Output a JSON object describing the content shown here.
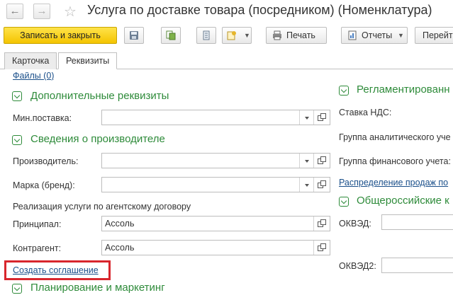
{
  "header": {
    "title": "Услуга по доставке товара (посредником) (Номенклатура)"
  },
  "toolbar": {
    "save_close_label": "Записать и закрыть",
    "print_label": "Печать",
    "reports_label": "Отчеты",
    "goto_label": "Перейт"
  },
  "tabs": [
    {
      "label": "Карточка"
    },
    {
      "label": "Реквизиты"
    }
  ],
  "files_link": "Файлы (0)",
  "additional": {
    "title": "Дополнительные реквизиты",
    "min_supply_label": "Мин.поставка:",
    "min_supply_value": ""
  },
  "manufacturer": {
    "title": "Сведения о производителе",
    "producer_label": "Производитель:",
    "producer_value": "",
    "brand_label": "Марка (бренд):",
    "brand_value": ""
  },
  "agency": {
    "caption": "Реализация услуги по агентскому договору",
    "principal_label": "Принципал:",
    "principal_value": "Ассоль",
    "counterparty_label": "Контрагент:",
    "counterparty_value": "Ассоль",
    "create_agreement_link": "Создать соглашение"
  },
  "planning": {
    "title": "Планирование и маркетинг"
  },
  "regulated": {
    "title": "Регламентированн",
    "vat_label": "Ставка НДС:",
    "analytic_group_label": "Группа аналитического уче",
    "finance_group_label": "Группа финансового учета:",
    "sales_distribution_link": "Распределение продаж по"
  },
  "okved": {
    "title": "Общероссийские к",
    "okved_label": "ОКВЭД:",
    "okved2_label": "ОКВЭД2:"
  },
  "colors": {
    "accent_green": "#2e8b3a",
    "link_blue": "#1a4f8a",
    "primary_yellow": "#f4c400",
    "highlight_red": "#d8262d"
  }
}
